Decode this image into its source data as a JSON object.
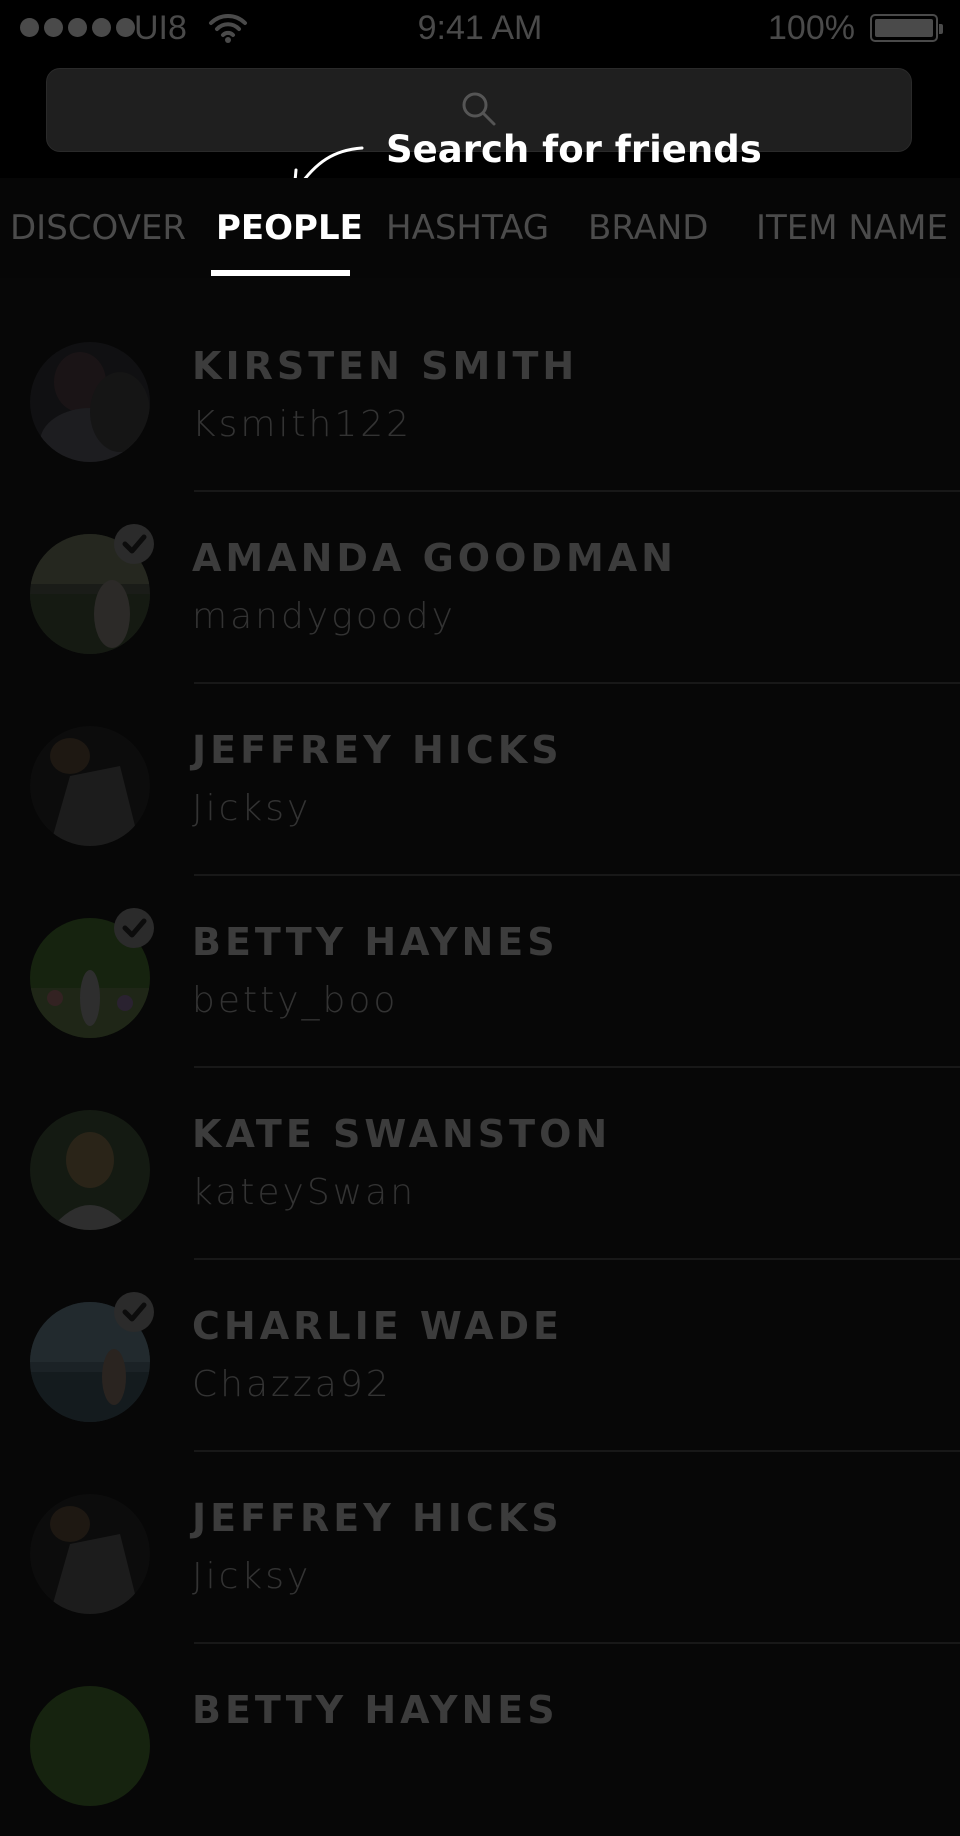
{
  "status_bar": {
    "carrier": "UI8",
    "time": "9:41 AM",
    "battery": "100%",
    "signal_icon": "signal-dots-icon",
    "wifi_icon": "wifi-icon",
    "battery_icon": "battery-icon"
  },
  "search": {
    "icon": "search-icon",
    "value": ""
  },
  "tooltip": {
    "text": "Search for friends",
    "arrow_icon": "curved-arrow-icon"
  },
  "tabs": [
    {
      "label": "DISCOVER",
      "active": false
    },
    {
      "label": "PEOPLE",
      "active": true
    },
    {
      "label": "HASHTAG",
      "active": false
    },
    {
      "label": "BRAND",
      "active": false
    },
    {
      "label": "ITEM NAME",
      "active": false
    }
  ],
  "people": [
    {
      "name": "KIRSTEN SMITH",
      "handle": "Ksmith122",
      "verified": false
    },
    {
      "name": "AMANDA GOODMAN",
      "handle": "mandygoody",
      "verified": true
    },
    {
      "name": "JEFFREY HICKS",
      "handle": "Jicksy",
      "verified": false
    },
    {
      "name": "BETTY HAYNES",
      "handle": "betty_boo",
      "verified": true
    },
    {
      "name": "KATE SWANSTON",
      "handle": "kateySwan",
      "verified": false
    },
    {
      "name": "CHARLIE WADE",
      "handle": "Chazza92",
      "verified": true
    },
    {
      "name": "JEFFREY HICKS",
      "handle": "Jicksy",
      "verified": false
    },
    {
      "name": "BETTY HAYNES",
      "handle": "",
      "verified": false
    }
  ],
  "colors": {
    "background": "#070707",
    "active_tab": "#ffffff",
    "inactive_tab": "#4b4b4b",
    "dim_text": "#3c3c3c"
  }
}
